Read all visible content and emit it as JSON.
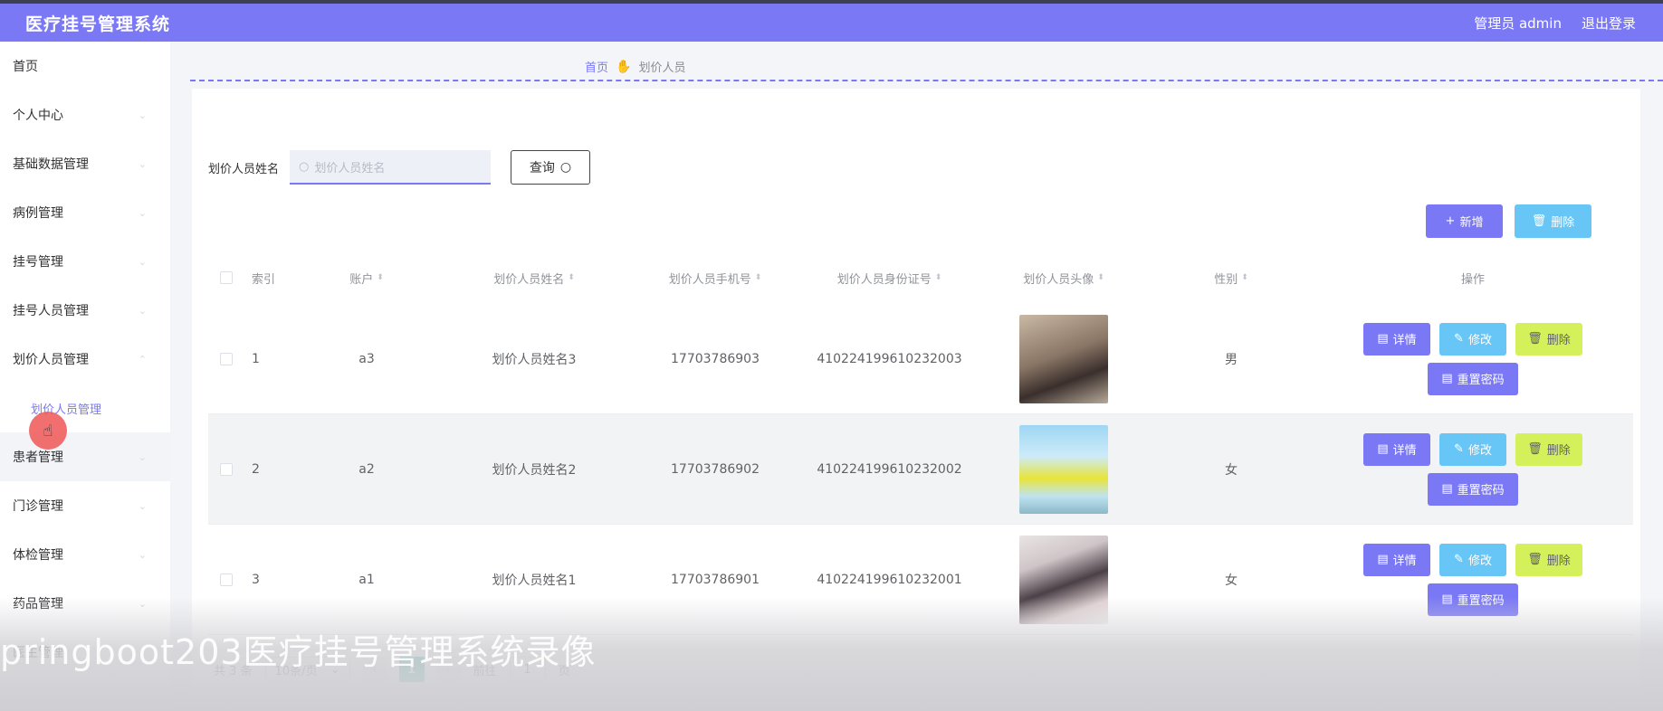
{
  "header": {
    "title": "医疗挂号管理系统",
    "admin": "管理员 admin",
    "logout": "退出登录"
  },
  "sidebar": {
    "items": [
      {
        "label": "首页"
      },
      {
        "label": "个人中心"
      },
      {
        "label": "基础数据管理"
      },
      {
        "label": "病例管理"
      },
      {
        "label": "挂号管理"
      },
      {
        "label": "挂号人员管理"
      },
      {
        "label": "划价人员管理"
      },
      {
        "label": "划价人员管理"
      },
      {
        "label": "患者管理"
      },
      {
        "label": "门诊管理"
      },
      {
        "label": "体检管理"
      },
      {
        "label": "药品管理"
      },
      {
        "label": "医生管理"
      }
    ]
  },
  "breadcrumb": {
    "home": "首页",
    "current": "划价人员"
  },
  "search": {
    "label": "划价人员姓名",
    "placeholder": "划价人员姓名",
    "button": "查询"
  },
  "actions": {
    "add": "新增",
    "delete": "删除"
  },
  "table": {
    "columns": [
      "索引",
      "账户",
      "划价人员姓名",
      "划价人员手机号",
      "划价人员身份证号",
      "划价人员头像",
      "性别",
      "操作"
    ],
    "rows": [
      {
        "index": "1",
        "account": "a3",
        "name": "划价人员姓名3",
        "phone": "17703786903",
        "id_number": "410224199610232003",
        "gender": "男"
      },
      {
        "index": "2",
        "account": "a2",
        "name": "划价人员姓名2",
        "phone": "17703786902",
        "id_number": "410224199610232002",
        "gender": "女"
      },
      {
        "index": "3",
        "account": "a1",
        "name": "划价人员姓名1",
        "phone": "17703786901",
        "id_number": "410224199610232001",
        "gender": "女"
      }
    ],
    "row_actions": {
      "detail": "详情",
      "edit": "修改",
      "delete": "删除",
      "reset": "重置密码"
    }
  },
  "pager": {
    "total": "共 3 条",
    "size": "10条/页",
    "page": "1",
    "goto_prefix": "前往",
    "goto_value": "1",
    "goto_suffix": "页"
  },
  "watermark": "pringboot203医疗挂号管理系统录像",
  "colors": {
    "primary": "#7a78f5",
    "info": "#67c6f5",
    "warn": "#d4f05a",
    "page_active": "#26a69a"
  }
}
